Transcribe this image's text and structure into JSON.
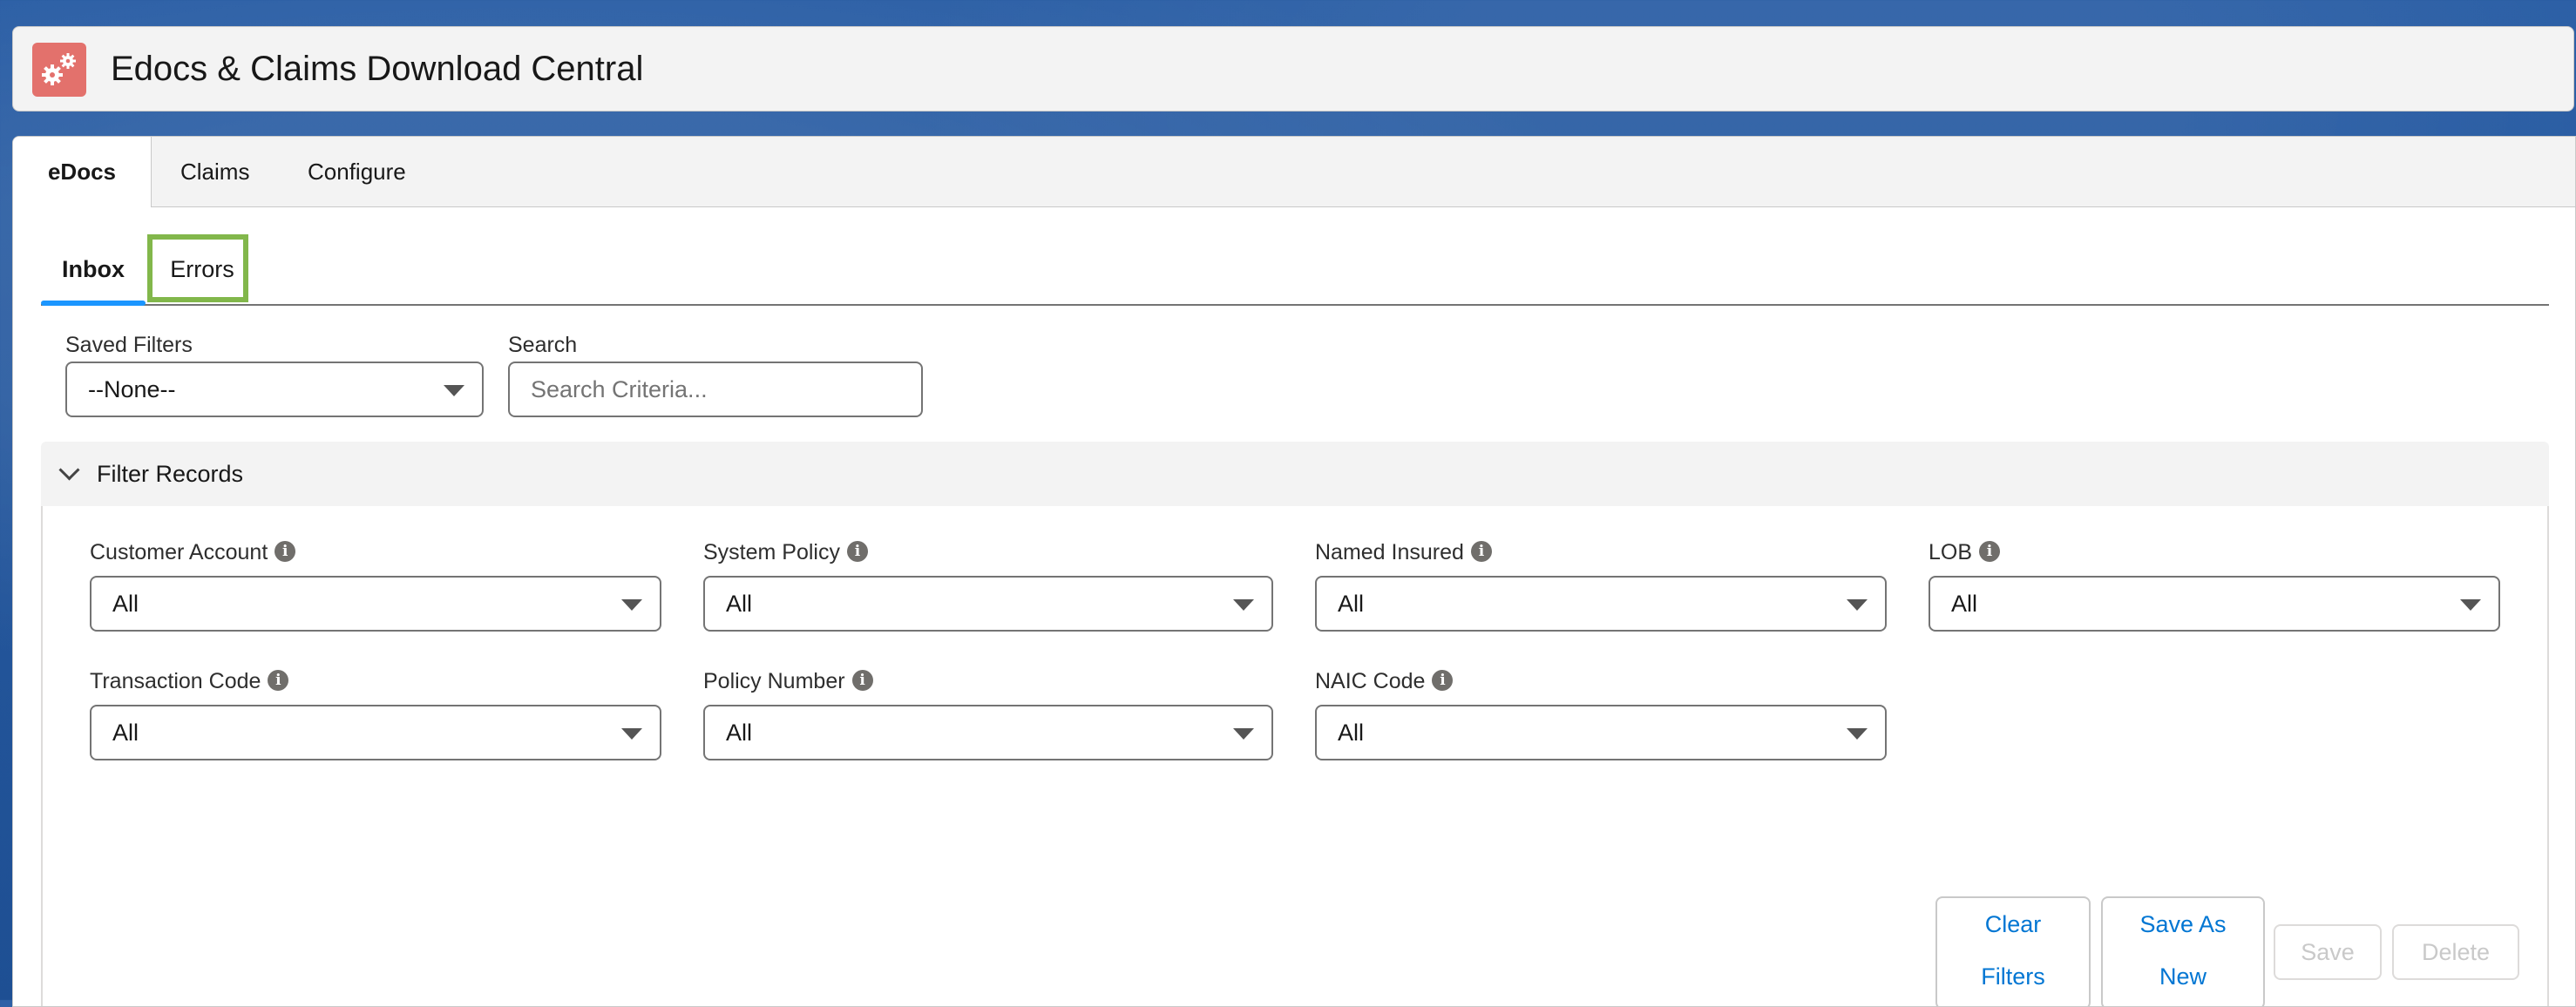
{
  "app": {
    "title": "Edocs & Claims Download Central",
    "icon": "gears-icon",
    "icon_color": "#e3716c"
  },
  "top_tabs": [
    {
      "label": "eDocs",
      "active": true
    },
    {
      "label": "Claims",
      "active": false
    },
    {
      "label": "Configure",
      "active": false
    }
  ],
  "sub_tabs": [
    {
      "label": "Inbox",
      "active": true
    },
    {
      "label": "Errors",
      "active": false,
      "highlighted": true
    }
  ],
  "saved_filters": {
    "label": "Saved Filters",
    "value": "--None--"
  },
  "search": {
    "label": "Search",
    "placeholder": "Search Criteria..."
  },
  "filter_section": {
    "title": "Filter Records",
    "expanded": true,
    "fields": [
      {
        "label": "Customer Account",
        "value": "All"
      },
      {
        "label": "System Policy",
        "value": "All"
      },
      {
        "label": "Named Insured",
        "value": "All"
      },
      {
        "label": "LOB",
        "value": "All"
      },
      {
        "label": "Transaction Code",
        "value": "All"
      },
      {
        "label": "Policy Number",
        "value": "All"
      },
      {
        "label": "NAIC Code",
        "value": "All"
      }
    ]
  },
  "buttons": {
    "clear_filters_line1": "Clear",
    "clear_filters_line2": "Filters",
    "save_as_new_line1": "Save As",
    "save_as_new_line2": "New",
    "save": "Save",
    "delete": "Delete"
  },
  "colors": {
    "accent": "#1b96ff",
    "link": "#0176d3",
    "highlight": "#82b74b"
  }
}
